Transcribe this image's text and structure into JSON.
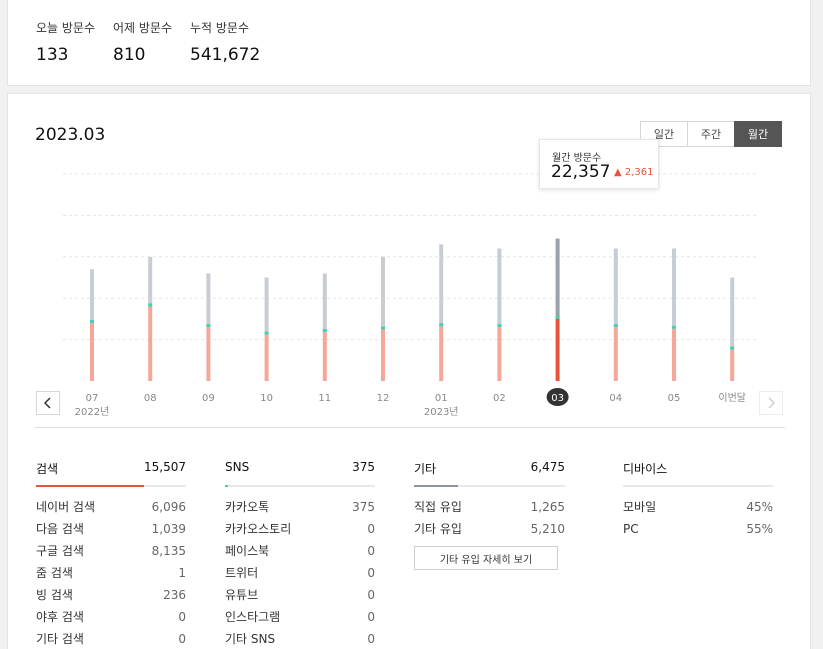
{
  "stats": [
    {
      "label": "오늘 방문수",
      "value": "133"
    },
    {
      "label": "어제 방문수",
      "value": "810"
    },
    {
      "label": "누적 방문수",
      "value": "541,672"
    }
  ],
  "period_title": "2023.03",
  "period_tabs": [
    {
      "label": "일간",
      "active": false
    },
    {
      "label": "주간",
      "active": false
    },
    {
      "label": "월간",
      "active": true
    }
  ],
  "tooltip": {
    "label": "월간 방문수",
    "value": "22,357",
    "delta": "▲ 2,361"
  },
  "colors": {
    "accent": "#e8533d",
    "bar_light": "#f5a89a",
    "bar_top": "#c8cdd3",
    "bar_top_active": "#9aa1ab",
    "mint": "#3fd1b4"
  },
  "chart_data": {
    "type": "bar",
    "categories": [
      "07",
      "08",
      "09",
      "10",
      "11",
      "12",
      "01",
      "02",
      "03",
      "04",
      "05",
      "이번달"
    ],
    "year_labels": [
      "2022년",
      "2023년"
    ],
    "selected": "03",
    "series": [
      {
        "values": [
          13500,
          15000,
          13000,
          12500,
          13000,
          15000,
          16500,
          16000,
          17200,
          16000,
          16000,
          12500
        ]
      },
      {
        "values": [
          7000,
          9000,
          6500,
          5600,
          5900,
          6200,
          6600,
          6500,
          7500,
          6500,
          6300,
          3800
        ]
      }
    ],
    "ylim": [
      0,
      25000
    ],
    "grid": true
  },
  "columns": [
    {
      "title": "검색",
      "total": "15,507",
      "fill": 0.72,
      "color": "#e8533d",
      "rows": [
        {
          "label": "네이버 검색",
          "value": "6,096"
        },
        {
          "label": "다음 검색",
          "value": "1,039"
        },
        {
          "label": "구글 검색",
          "value": "8,135"
        },
        {
          "label": "줌 검색",
          "value": "1"
        },
        {
          "label": "빙 검색",
          "value": "236"
        },
        {
          "label": "야후 검색",
          "value": "0"
        },
        {
          "label": "기타 검색",
          "value": "0"
        }
      ]
    },
    {
      "title": "SNS",
      "total": "375",
      "fill": 0.02,
      "color": "#3fd1b4",
      "rows": [
        {
          "label": "카카오톡",
          "value": "375"
        },
        {
          "label": "카카오스토리",
          "value": "0"
        },
        {
          "label": "페이스북",
          "value": "0"
        },
        {
          "label": "트위터",
          "value": "0"
        },
        {
          "label": "유튜브",
          "value": "0"
        },
        {
          "label": "인스타그램",
          "value": "0"
        },
        {
          "label": "기타 SNS",
          "value": "0"
        }
      ]
    },
    {
      "title": "기타",
      "total": "6,475",
      "fill": 0.29,
      "color": "#8e949c",
      "rows": [
        {
          "label": "직접 유입",
          "value": "1,265"
        },
        {
          "label": "기타 유입",
          "value": "5,210"
        }
      ],
      "button": "기타 유입 자세히 보기"
    },
    {
      "title": "디바이스",
      "total": "",
      "fill": 0,
      "color": "#8e949c",
      "rows": [
        {
          "label": "모바일",
          "value": "45%"
        },
        {
          "label": "PC",
          "value": "55%"
        }
      ]
    }
  ]
}
